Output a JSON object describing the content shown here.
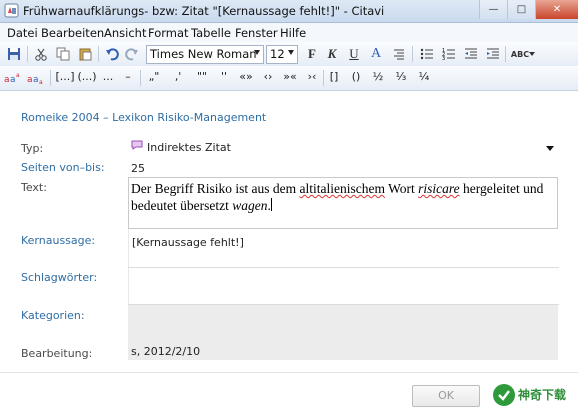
{
  "window": {
    "title": "Frühwarnaufklärungs- bzw: Zitat \"[Kernaussage fehlt!]\" - Citavi",
    "minimize": "—",
    "maximize": "□",
    "close": "✕"
  },
  "menu": [
    "Datei",
    "Bearbeiten",
    "Ansicht",
    "Format",
    "Tabelle",
    "Fenster",
    "Hilfe"
  ],
  "toolbar": {
    "font_name": "Times New Roman",
    "font_size": "12",
    "bold": "F",
    "italic": "K",
    "underline": "U",
    "font_color": "A",
    "spellcheck": "ABC"
  },
  "symbols": [
    "[...]",
    "(...)",
    "...",
    "–",
    "„\"",
    "‚'",
    "\"\"",
    "''",
    "«»",
    "‹›",
    "»«",
    "›‹",
    "[]",
    "()",
    "½",
    "⅓",
    "¼"
  ],
  "form": {
    "source": "Romeike 2004 – Lexikon Risiko-Management",
    "type_label": "Typ:",
    "type_value": "Indirektes Zitat",
    "pages_label": "Seiten von–bis:",
    "pages_value": "25",
    "text_label": "Text:",
    "text_part1": "Der Begriff Risiko ist aus dem ",
    "text_misspelled": "altitalienischem",
    "text_part2": " Wort ",
    "text_italic1": "risicare",
    "text_part3": " hergeleitet und bedeutet übersetzt ",
    "text_italic2": "wagen",
    "text_part4": ".",
    "key_label": "Kernaussage:",
    "key_value": "[Kernaussage fehlt!]",
    "keywords_label": "Schlagwörter:",
    "categories_label": "Kategorien:",
    "edit_label": "Bearbeitung:",
    "edit_value": "s, 2012/2/10"
  },
  "buttons": {
    "ok": "OK"
  },
  "watermark": {
    "text": "神奇下载"
  },
  "colors": {
    "link_blue": "#2f6da4",
    "titlebar": "#c9d9ee"
  }
}
